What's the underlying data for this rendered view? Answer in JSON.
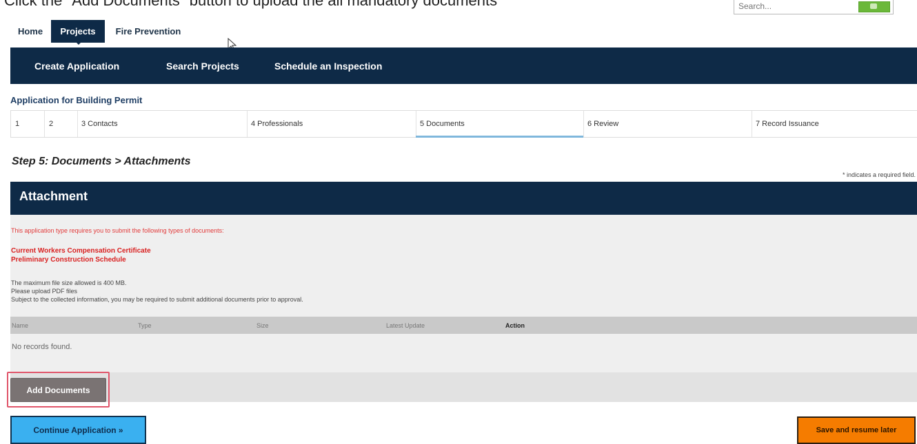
{
  "top_instruction": "Click the \"Add Documents\" button to upload the all mandatory documents",
  "search": {
    "placeholder": "Search..."
  },
  "nav": {
    "home": "Home",
    "projects": "Projects",
    "fire_prevention": "Fire Prevention"
  },
  "subnav": {
    "create_application": "Create Application",
    "search_projects": "Search Projects",
    "schedule_inspection": "Schedule an Inspection"
  },
  "app_title": "Application for Building Permit",
  "steps": [
    {
      "label": "1"
    },
    {
      "label": "2"
    },
    {
      "label": "3 Contacts"
    },
    {
      "label": "4 Professionals"
    },
    {
      "label": "5 Documents"
    },
    {
      "label": "6 Review"
    },
    {
      "label": "7 Record Issuance"
    }
  ],
  "active_step": "5 Documents",
  "step_heading": "Step 5: Documents > Attachments",
  "required_note": "* indicates a required field.",
  "attachment": {
    "title": "Attachment",
    "requirement_note": "This application type requires you to submit the following types of documents:",
    "required_docs": [
      "Current Workers Compensation Certificate",
      "Preliminary Construction Schedule"
    ],
    "info_lines": [
      "The maximum file size allowed is 400 MB.",
      "Please upload PDF files",
      "Subject to the collected information, you may be required to submit additional documents prior to approval."
    ],
    "table_headers": [
      "Name",
      "Type",
      "Size",
      "Latest Update",
      "Action"
    ],
    "no_records": "No records found.",
    "add_button": "Add Documents"
  },
  "buttons": {
    "continue": "Continue Application »",
    "save": "Save and resume later"
  },
  "colors": {
    "navy": "#0e2a47",
    "continue_blue": "#3ab0f0",
    "save_orange": "#f57c00",
    "required_red": "#d92020"
  }
}
